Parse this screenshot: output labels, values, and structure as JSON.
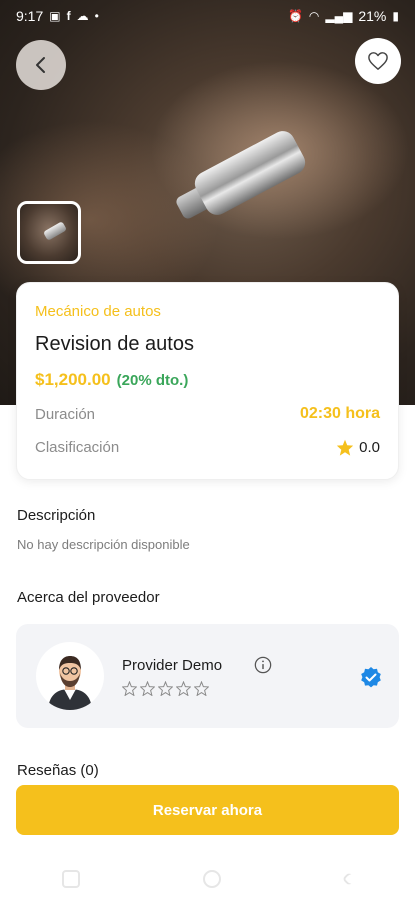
{
  "status_bar": {
    "time": "9:17",
    "battery": "21%"
  },
  "service": {
    "category": "Mecánico de autos",
    "title": "Revision de autos",
    "price": "$1,200.00",
    "discount": "(20% dto.)",
    "duration_label": "Duración",
    "duration_value": "02:30 hora",
    "rating_label": "Clasificación",
    "rating_value": "0.0"
  },
  "description": {
    "title": "Descripción",
    "text": "No hay descripción disponible"
  },
  "provider": {
    "section_title": "Acerca del proveedor",
    "name": "Provider Demo",
    "stars": 0
  },
  "reviews": {
    "title": "Reseñas (0)"
  },
  "actions": {
    "reserve_label": "Reservar ahora"
  },
  "colors": {
    "accent": "#f5c01c",
    "discount": "#3aa65a",
    "verified": "#1e88e5"
  }
}
